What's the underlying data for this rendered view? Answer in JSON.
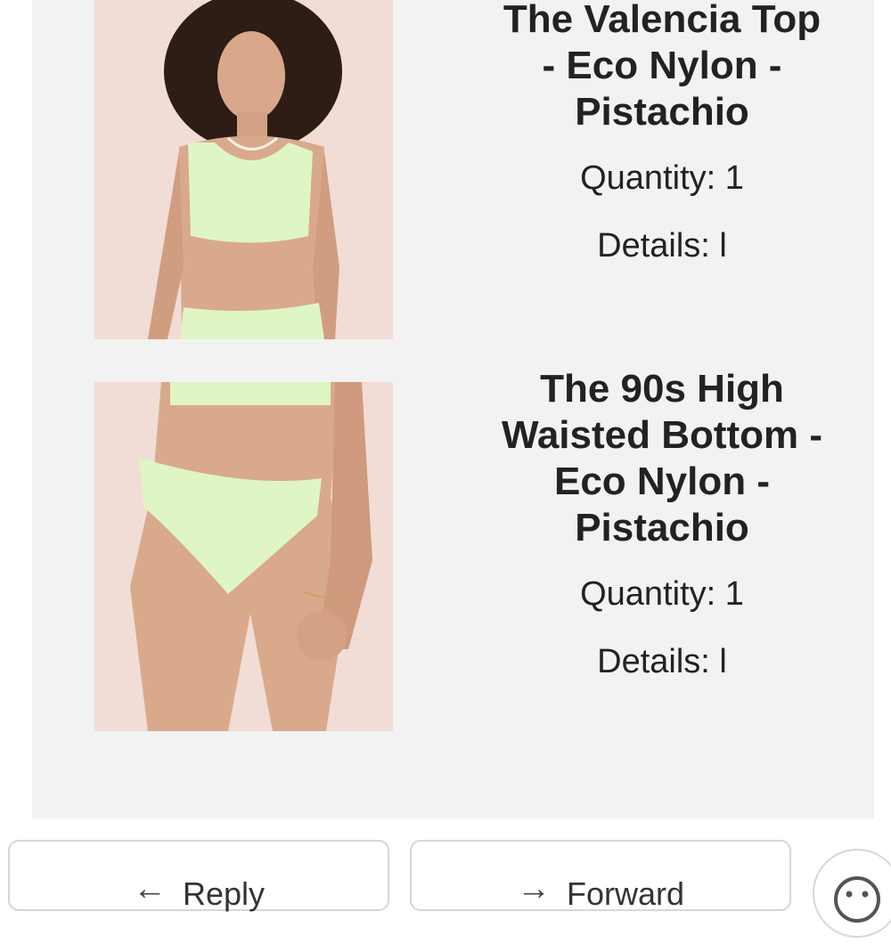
{
  "items": [
    {
      "title": "The Valencia Top - Eco Nylon - Pistachio",
      "quantity": "Quantity: 1",
      "details": "Details: l",
      "image": "valencia-top-photo"
    },
    {
      "title": "The 90s High Waisted Bottom - Eco Nylon - Pistachio",
      "quantity": "Quantity: 1",
      "details": "Details: l",
      "image": "high-waisted-bottom-photo"
    }
  ],
  "actions": {
    "reply_label": "Reply",
    "reply_icon": "reply-arrow-icon",
    "forward_label": "Forward",
    "forward_icon": "forward-arrow-icon",
    "emoji_icon": "emoji-reaction-icon"
  },
  "colors": {
    "panel_bg": "#f2f2f2",
    "swimwear": "#dff5c4",
    "photo_bg": "#f1ddd5"
  }
}
